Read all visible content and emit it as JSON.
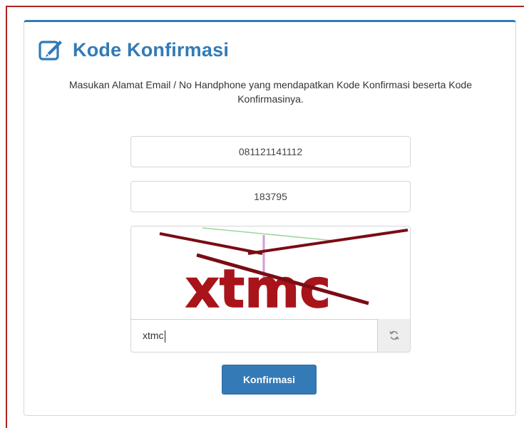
{
  "panel": {
    "icon": "edit-icon",
    "title": "Kode Konfirmasi",
    "description": "Masukan Alamat Email / No Handphone yang mendapatkan Kode Konfirmasi beserta Kode Konfirmasinya."
  },
  "form": {
    "phone_value": "081121141112",
    "code_value": "183795",
    "captcha_text": "xtmc",
    "captcha_input_value": "xtmc",
    "refresh_icon": "refresh-icon",
    "submit_label": "Konfirmasi"
  },
  "colors": {
    "accent": "#337ab7",
    "frame_border": "#b22222",
    "captcha_text": "#a8141a"
  }
}
